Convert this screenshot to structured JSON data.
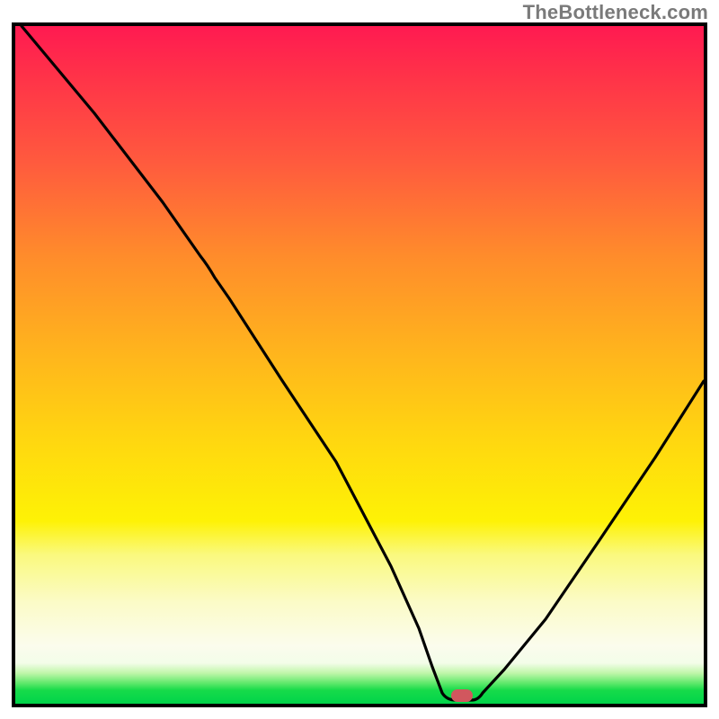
{
  "watermark": "TheBottleneck.com",
  "colors": {
    "border": "#000000",
    "curve": "#000000",
    "marker": "#d1575e",
    "gradient_stops": [
      {
        "pos": 0.0,
        "hex": "#ff1a51"
      },
      {
        "pos": 0.07,
        "hex": "#ff3149"
      },
      {
        "pos": 0.2,
        "hex": "#ff5a3e"
      },
      {
        "pos": 0.34,
        "hex": "#ff8c2b"
      },
      {
        "pos": 0.48,
        "hex": "#ffb41d"
      },
      {
        "pos": 0.62,
        "hex": "#ffd90f"
      },
      {
        "pos": 0.73,
        "hex": "#fef205"
      },
      {
        "pos": 0.78,
        "hex": "#faf97e"
      },
      {
        "pos": 0.85,
        "hex": "#fbfbc7"
      },
      {
        "pos": 0.915,
        "hex": "#fbfced"
      },
      {
        "pos": 0.94,
        "hex": "#f3fde9"
      },
      {
        "pos": 0.955,
        "hex": "#bff6a9"
      },
      {
        "pos": 0.97,
        "hex": "#5de86a"
      },
      {
        "pos": 0.98,
        "hex": "#17db4a"
      },
      {
        "pos": 1.0,
        "hex": "#00d44a"
      }
    ]
  },
  "chart_data": {
    "type": "line",
    "title": "",
    "xlabel": "",
    "ylabel": "",
    "xlim": [
      0,
      100
    ],
    "ylim": [
      0,
      100
    ],
    "note": "V-shaped bottleneck curve; the curve minimum (green zone) sits near x ≈ 64. Left branch descends from top-left (value 100 at x=0) to the floor, has a slight slope change near x≈26 (y≈66). Right branch rises from the floor after the minimum, reaching ≈48 at the right edge. A small rounded marker indicates the recommended configuration at the curve's minimum.",
    "series": [
      {
        "name": "bottleneck-curve",
        "x": [
          0,
          10,
          20,
          26,
          30,
          38,
          46,
          54,
          58,
          60,
          62,
          64,
          66,
          70,
          76,
          84,
          92,
          100
        ],
        "y": [
          100,
          87,
          74,
          66,
          60,
          48,
          35,
          20,
          11,
          5,
          1,
          0,
          0,
          4,
          12,
          24,
          36,
          48
        ]
      }
    ],
    "marker": {
      "x": 64,
      "y": 0
    }
  }
}
